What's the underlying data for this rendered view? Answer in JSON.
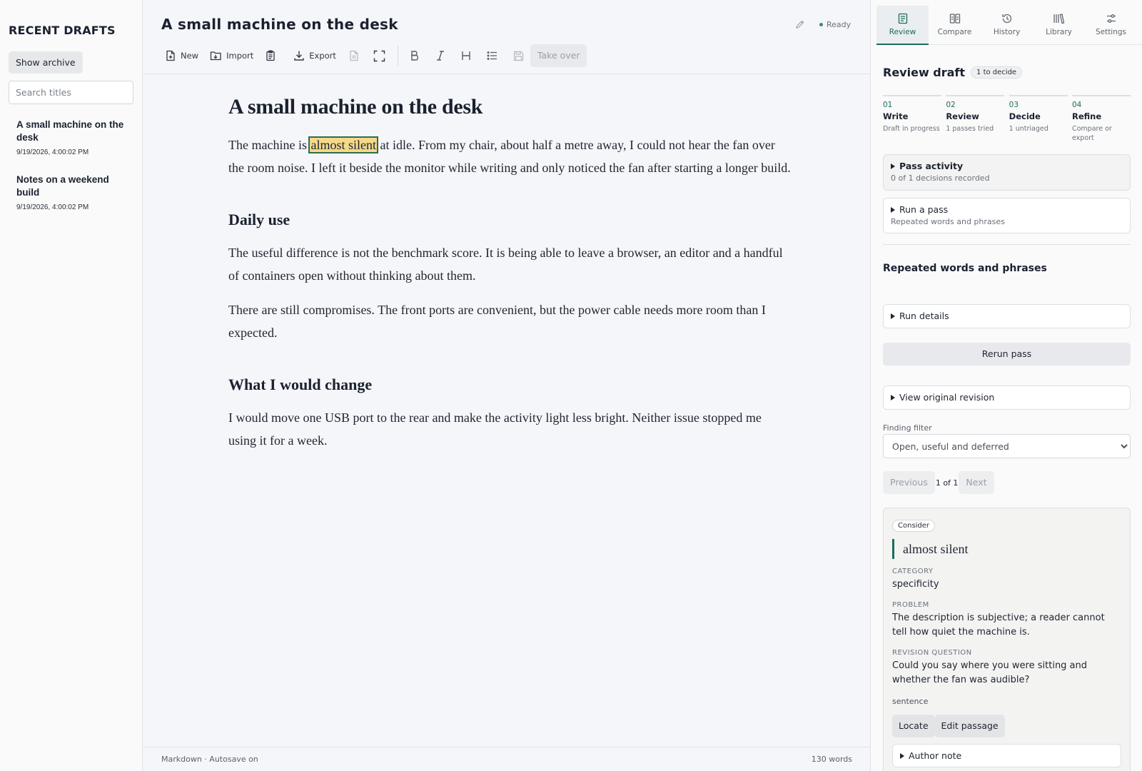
{
  "sidebar": {
    "title": "RECENT DRAFTS",
    "archive_button": "Show archive",
    "search_placeholder": "Search titles",
    "drafts": [
      {
        "title": "A small machine on the desk",
        "date": "9/19/2026, 4:00:02 PM"
      },
      {
        "title": "Notes on a weekend build",
        "date": "9/19/2026, 4:00:02 PM"
      }
    ]
  },
  "editor": {
    "title": "A small machine on the desk",
    "status": "Ready",
    "toolbar": {
      "new": "New",
      "import": "Import",
      "export": "Export",
      "take_over": "Take over"
    },
    "doc": {
      "h1": "A small machine on the desk",
      "p1_before": "The machine is ",
      "p1_highlight": "almost silent",
      "p1_after": " at idle. From my chair, about half a metre away, I could not hear the fan over the room noise. I left it beside the monitor while writing and only noticed the fan after starting a longer build.",
      "h2a": "Daily use",
      "p2": "The useful difference is not the benchmark score. It is being able to leave a browser, an editor and a handful of containers open without thinking about them.",
      "p3": "There are still compromises. The front ports are convenient, but the power cable needs more room than I expected.",
      "h2b": "What I would change",
      "p4": "I would move one USB port to the rear and make the activity light less bright. Neither issue stopped me using it for a week."
    },
    "footer": {
      "mode": "Markdown · Autosave on",
      "word_count": "130 words"
    }
  },
  "panel": {
    "tabs": [
      {
        "label": "Review",
        "icon": "review-icon"
      },
      {
        "label": "Compare",
        "icon": "compare-icon"
      },
      {
        "label": "History",
        "icon": "history-icon"
      },
      {
        "label": "Library",
        "icon": "library-icon"
      },
      {
        "label": "Settings",
        "icon": "settings-icon"
      }
    ],
    "review_title": "Review draft",
    "decide_badge": "1 to decide",
    "steps": [
      {
        "num": "01",
        "name": "Write",
        "sub": "Draft in progress"
      },
      {
        "num": "02",
        "name": "Review",
        "sub": "1 passes tried"
      },
      {
        "num": "03",
        "name": "Decide",
        "sub": "1 untriaged"
      },
      {
        "num": "04",
        "name": "Refine",
        "sub": "Compare or export"
      }
    ],
    "pass_activity": {
      "title": "Pass activity",
      "sub": "0 of 1 decisions recorded"
    },
    "run_pass": {
      "title": "Run a pass",
      "sub": "Repeated words and phrases"
    },
    "section_title": "Repeated words and phrases",
    "run_details": "Run details",
    "rerun": "Rerun pass",
    "view_original": "View original revision",
    "filter_label": "Finding filter",
    "filter_value": "Open, useful and deferred",
    "pager": {
      "prev": "Previous",
      "count": "1 of 1",
      "next": "Next"
    },
    "finding": {
      "badge": "Consider",
      "quote": "almost silent",
      "category_label": "CATEGORY",
      "category": "specificity",
      "problem_label": "PROBLEM",
      "problem": "The description is subjective; a reader cannot tell how quiet the machine is.",
      "question_label": "REVISION QUESTION",
      "question": "Could you say where you were sitting and whether the fan was audible?",
      "scope": "sentence",
      "locate": "Locate",
      "edit": "Edit passage",
      "author_note": "Author note"
    }
  },
  "colors": {
    "accent": "#1f6b5c",
    "highlight": "#f5d98a"
  }
}
